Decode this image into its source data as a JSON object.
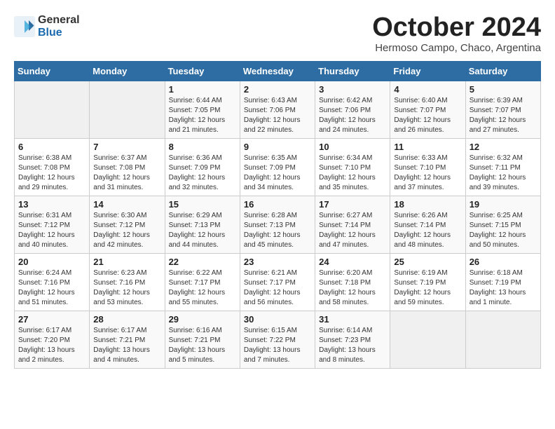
{
  "logo": {
    "general": "General",
    "blue": "Blue"
  },
  "header": {
    "title": "October 2024",
    "subtitle": "Hermoso Campo, Chaco, Argentina"
  },
  "weekdays": [
    "Sunday",
    "Monday",
    "Tuesday",
    "Wednesday",
    "Thursday",
    "Friday",
    "Saturday"
  ],
  "weeks": [
    [
      {
        "day": "",
        "sunrise": "",
        "sunset": "",
        "daylight": ""
      },
      {
        "day": "",
        "sunrise": "",
        "sunset": "",
        "daylight": ""
      },
      {
        "day": "1",
        "sunrise": "Sunrise: 6:44 AM",
        "sunset": "Sunset: 7:05 PM",
        "daylight": "Daylight: 12 hours and 21 minutes."
      },
      {
        "day": "2",
        "sunrise": "Sunrise: 6:43 AM",
        "sunset": "Sunset: 7:06 PM",
        "daylight": "Daylight: 12 hours and 22 minutes."
      },
      {
        "day": "3",
        "sunrise": "Sunrise: 6:42 AM",
        "sunset": "Sunset: 7:06 PM",
        "daylight": "Daylight: 12 hours and 24 minutes."
      },
      {
        "day": "4",
        "sunrise": "Sunrise: 6:40 AM",
        "sunset": "Sunset: 7:07 PM",
        "daylight": "Daylight: 12 hours and 26 minutes."
      },
      {
        "day": "5",
        "sunrise": "Sunrise: 6:39 AM",
        "sunset": "Sunset: 7:07 PM",
        "daylight": "Daylight: 12 hours and 27 minutes."
      }
    ],
    [
      {
        "day": "6",
        "sunrise": "Sunrise: 6:38 AM",
        "sunset": "Sunset: 7:08 PM",
        "daylight": "Daylight: 12 hours and 29 minutes."
      },
      {
        "day": "7",
        "sunrise": "Sunrise: 6:37 AM",
        "sunset": "Sunset: 7:08 PM",
        "daylight": "Daylight: 12 hours and 31 minutes."
      },
      {
        "day": "8",
        "sunrise": "Sunrise: 6:36 AM",
        "sunset": "Sunset: 7:09 PM",
        "daylight": "Daylight: 12 hours and 32 minutes."
      },
      {
        "day": "9",
        "sunrise": "Sunrise: 6:35 AM",
        "sunset": "Sunset: 7:09 PM",
        "daylight": "Daylight: 12 hours and 34 minutes."
      },
      {
        "day": "10",
        "sunrise": "Sunrise: 6:34 AM",
        "sunset": "Sunset: 7:10 PM",
        "daylight": "Daylight: 12 hours and 35 minutes."
      },
      {
        "day": "11",
        "sunrise": "Sunrise: 6:33 AM",
        "sunset": "Sunset: 7:10 PM",
        "daylight": "Daylight: 12 hours and 37 minutes."
      },
      {
        "day": "12",
        "sunrise": "Sunrise: 6:32 AM",
        "sunset": "Sunset: 7:11 PM",
        "daylight": "Daylight: 12 hours and 39 minutes."
      }
    ],
    [
      {
        "day": "13",
        "sunrise": "Sunrise: 6:31 AM",
        "sunset": "Sunset: 7:12 PM",
        "daylight": "Daylight: 12 hours and 40 minutes."
      },
      {
        "day": "14",
        "sunrise": "Sunrise: 6:30 AM",
        "sunset": "Sunset: 7:12 PM",
        "daylight": "Daylight: 12 hours and 42 minutes."
      },
      {
        "day": "15",
        "sunrise": "Sunrise: 6:29 AM",
        "sunset": "Sunset: 7:13 PM",
        "daylight": "Daylight: 12 hours and 44 minutes."
      },
      {
        "day": "16",
        "sunrise": "Sunrise: 6:28 AM",
        "sunset": "Sunset: 7:13 PM",
        "daylight": "Daylight: 12 hours and 45 minutes."
      },
      {
        "day": "17",
        "sunrise": "Sunrise: 6:27 AM",
        "sunset": "Sunset: 7:14 PM",
        "daylight": "Daylight: 12 hours and 47 minutes."
      },
      {
        "day": "18",
        "sunrise": "Sunrise: 6:26 AM",
        "sunset": "Sunset: 7:14 PM",
        "daylight": "Daylight: 12 hours and 48 minutes."
      },
      {
        "day": "19",
        "sunrise": "Sunrise: 6:25 AM",
        "sunset": "Sunset: 7:15 PM",
        "daylight": "Daylight: 12 hours and 50 minutes."
      }
    ],
    [
      {
        "day": "20",
        "sunrise": "Sunrise: 6:24 AM",
        "sunset": "Sunset: 7:16 PM",
        "daylight": "Daylight: 12 hours and 51 minutes."
      },
      {
        "day": "21",
        "sunrise": "Sunrise: 6:23 AM",
        "sunset": "Sunset: 7:16 PM",
        "daylight": "Daylight: 12 hours and 53 minutes."
      },
      {
        "day": "22",
        "sunrise": "Sunrise: 6:22 AM",
        "sunset": "Sunset: 7:17 PM",
        "daylight": "Daylight: 12 hours and 55 minutes."
      },
      {
        "day": "23",
        "sunrise": "Sunrise: 6:21 AM",
        "sunset": "Sunset: 7:17 PM",
        "daylight": "Daylight: 12 hours and 56 minutes."
      },
      {
        "day": "24",
        "sunrise": "Sunrise: 6:20 AM",
        "sunset": "Sunset: 7:18 PM",
        "daylight": "Daylight: 12 hours and 58 minutes."
      },
      {
        "day": "25",
        "sunrise": "Sunrise: 6:19 AM",
        "sunset": "Sunset: 7:19 PM",
        "daylight": "Daylight: 12 hours and 59 minutes."
      },
      {
        "day": "26",
        "sunrise": "Sunrise: 6:18 AM",
        "sunset": "Sunset: 7:19 PM",
        "daylight": "Daylight: 13 hours and 1 minute."
      }
    ],
    [
      {
        "day": "27",
        "sunrise": "Sunrise: 6:17 AM",
        "sunset": "Sunset: 7:20 PM",
        "daylight": "Daylight: 13 hours and 2 minutes."
      },
      {
        "day": "28",
        "sunrise": "Sunrise: 6:17 AM",
        "sunset": "Sunset: 7:21 PM",
        "daylight": "Daylight: 13 hours and 4 minutes."
      },
      {
        "day": "29",
        "sunrise": "Sunrise: 6:16 AM",
        "sunset": "Sunset: 7:21 PM",
        "daylight": "Daylight: 13 hours and 5 minutes."
      },
      {
        "day": "30",
        "sunrise": "Sunrise: 6:15 AM",
        "sunset": "Sunset: 7:22 PM",
        "daylight": "Daylight: 13 hours and 7 minutes."
      },
      {
        "day": "31",
        "sunrise": "Sunrise: 6:14 AM",
        "sunset": "Sunset: 7:23 PM",
        "daylight": "Daylight: 13 hours and 8 minutes."
      },
      {
        "day": "",
        "sunrise": "",
        "sunset": "",
        "daylight": ""
      },
      {
        "day": "",
        "sunrise": "",
        "sunset": "",
        "daylight": ""
      }
    ]
  ]
}
